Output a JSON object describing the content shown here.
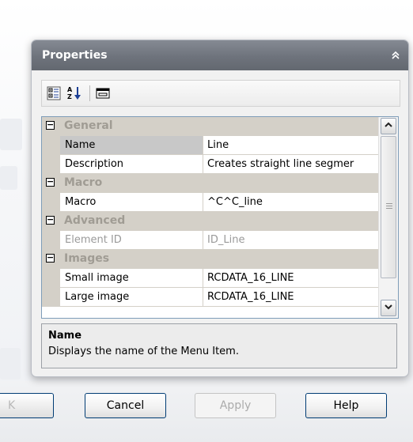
{
  "panel": {
    "title": "Properties",
    "collapse_icon": "chevron-double-up-icon"
  },
  "toolbar": {
    "buttons": [
      {
        "icon": "categorized-icon"
      },
      {
        "icon": "sort-alphabetical-icon"
      },
      {
        "icon": "property-pages-icon"
      }
    ]
  },
  "grid": {
    "categories": [
      {
        "label": "General",
        "expanded": true
      },
      {
        "label": "Macro",
        "expanded": true
      },
      {
        "label": "Advanced",
        "expanded": true
      },
      {
        "label": "Images",
        "expanded": true
      }
    ],
    "properties": [
      {
        "name": "Name",
        "value": "Line"
      },
      {
        "name": "Description",
        "value": "Creates straight line segmer"
      },
      {
        "name": "Macro",
        "value": "^C^C_line"
      },
      {
        "name": "Element ID",
        "value": "ID_Line"
      },
      {
        "name": "Small image",
        "value": "RCDATA_16_LINE"
      },
      {
        "name": "Large image",
        "value": "RCDATA_16_LINE"
      }
    ],
    "expander_glyph": "−"
  },
  "description": {
    "title": "Name",
    "text": "Displays the name of the Menu Item."
  },
  "buttons": {
    "ok": "K",
    "cancel": "Cancel",
    "apply": "Apply",
    "help": "Help"
  }
}
